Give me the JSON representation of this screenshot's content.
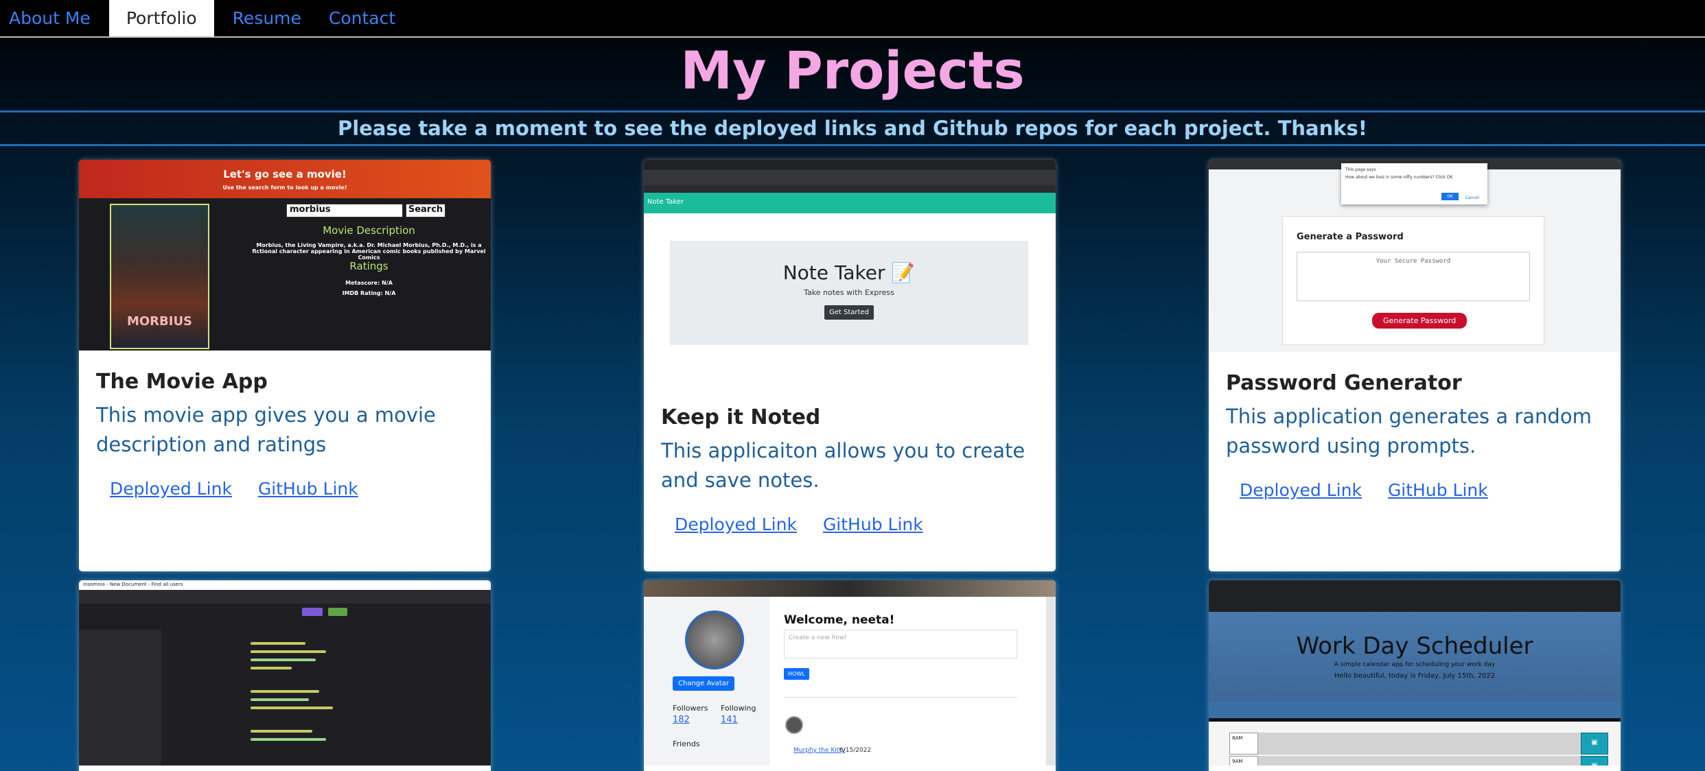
{
  "nav": {
    "items": [
      {
        "label": "About Me"
      },
      {
        "label": "Portfolio"
      },
      {
        "label": "Resume"
      },
      {
        "label": "Contact"
      }
    ]
  },
  "header": {
    "title": "My Projects",
    "subtitle": "Please take a moment to see the deployed links and Github repos for each project. Thanks!"
  },
  "cards": [
    {
      "title": "The Movie App",
      "description": "This movie app gives you a movie description and ratings",
      "deployed_label": "Deployed Link",
      "github_label": "GitHub Link",
      "screenshot": {
        "banner_title": "Let's go see a movie!",
        "banner_sub": "Use the search form to look up a movie!",
        "search_value": "morbius",
        "search_button": "Search",
        "poster_title": "MORBIUS",
        "description_heading": "Movie Description",
        "description_text": "Morbius, the Living Vampire, a.k.a. Dr. Michael Morbius, Ph.D., M.D., is a fictional character appearing in American comic books published by Marvel Comics",
        "ratings_heading": "Ratings",
        "metascore": "Metascore: N/A",
        "imdb": "IMDB Rating: N/A"
      }
    },
    {
      "title": "Keep it Noted",
      "description": "This applicaiton allows you to create and save notes.",
      "deployed_label": "Deployed Link",
      "github_label": "GitHub Link",
      "screenshot": {
        "bar_title": "Note Taker",
        "panel_title": "Note Taker 📝",
        "panel_sub": "Take notes with Express",
        "panel_button": "Get Started"
      }
    },
    {
      "title": "Password Generator",
      "description": "This application generates a random password using prompts.",
      "deployed_label": "Deployed Link",
      "github_label": "GitHub Link",
      "screenshot": {
        "dialog_title": "This page says",
        "dialog_text": "How about we toss in some nifty numbers? Click OK",
        "dialog_ok": "OK",
        "dialog_cancel": "Cancel",
        "box_title": "Generate a Password",
        "placeholder": "Your Secure Password",
        "button": "Generate Password"
      }
    },
    {
      "screenshot": {
        "app": "Insomnia - New Document - Find all users"
      }
    },
    {
      "screenshot": {
        "welcome": "Welcome, neeta!",
        "howl_placeholder": "Create a new howl",
        "howl_button": "HOWL",
        "change_avatar": "Change Avatar",
        "followers_label": "Followers",
        "followers_count": "182",
        "following_label": "Following",
        "following_count": "141",
        "friends_label": "Friends",
        "post_user": "Murphy the Kitty",
        "post_date": "6/15/2022"
      }
    },
    {
      "screenshot": {
        "title": "Work Day Scheduler",
        "subtitle": "A simple calendar app for scheduling your work day",
        "date_line": "Hello beautiful, today is Friday, July 15th, 2022",
        "slot1": "8AM",
        "slot2": "9AM"
      }
    }
  ],
  "colors": {
    "title": "#f5a6e4",
    "subtitle": "#9cd3f7",
    "link": "#2563eb",
    "nav_link": "#3b82f6"
  }
}
